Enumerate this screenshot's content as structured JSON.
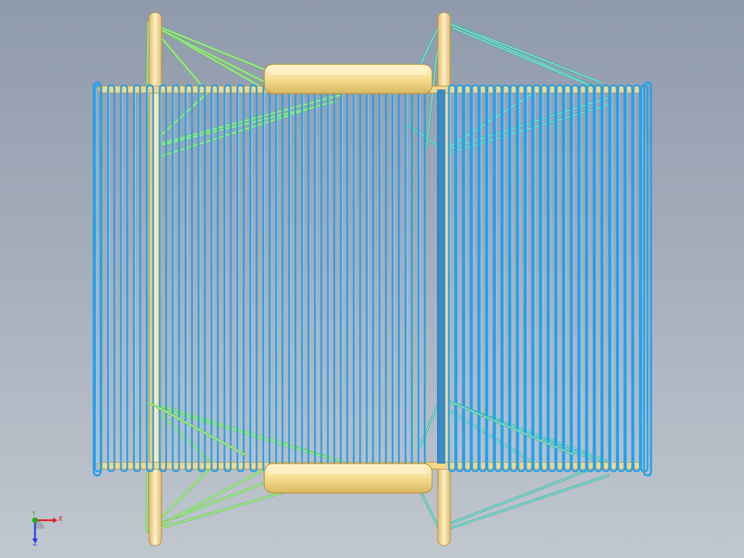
{
  "viewport": {
    "background_top": "#8f9aac",
    "background_bottom": "#c1c7cf"
  },
  "model": {
    "colors": {
      "coil_blue": "#2aa0e8",
      "coil_highlight": "#8fd6ff",
      "frame_yellow": "#f3d98a",
      "frame_highlight": "#fff4cc",
      "strut_green": "#6fd05a",
      "strut_teal": "#45b8a8"
    }
  },
  "triad": {
    "x_label": "X",
    "y_label": "Y",
    "z_label": "Z",
    "x_color": "#e02020",
    "y_color": "#20b020",
    "z_color": "#2040e0"
  }
}
